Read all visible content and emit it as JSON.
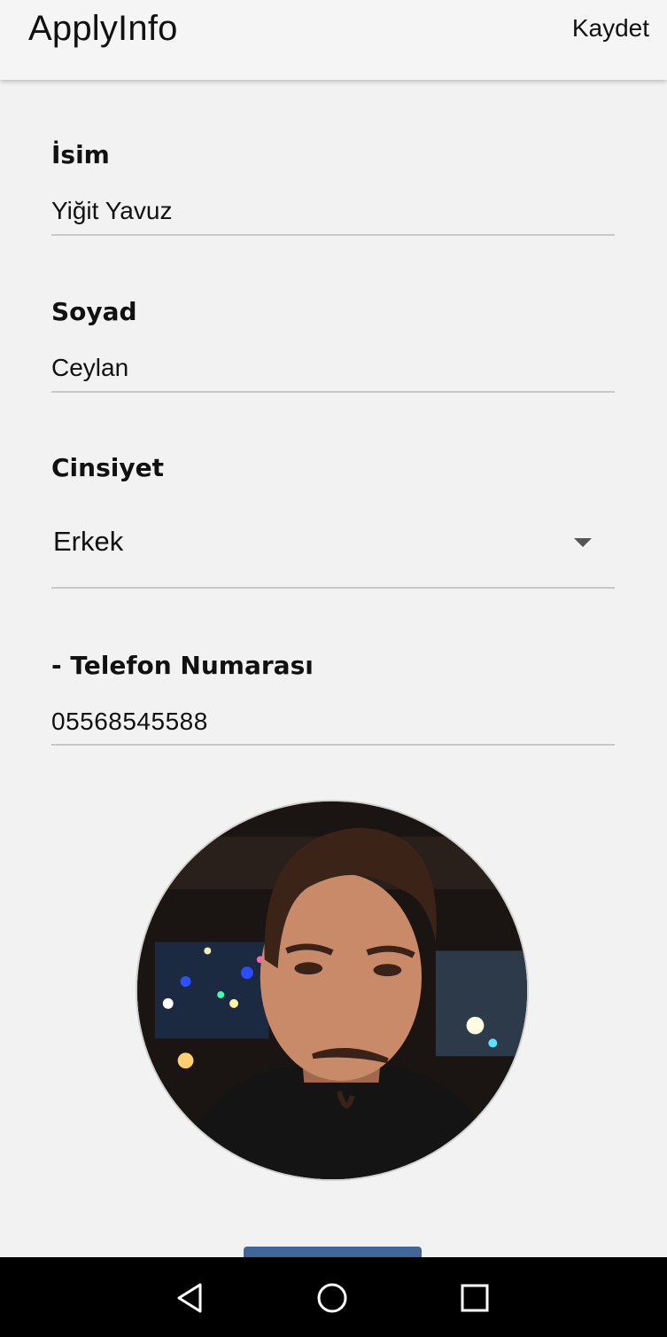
{
  "appbar": {
    "title": "ApplyInfo",
    "save_label": "Kaydet"
  },
  "form": {
    "first_name": {
      "label": "İsim",
      "value": "Yiğit Yavuz"
    },
    "last_name": {
      "label": "Soyad",
      "value": "Ceylan"
    },
    "gender": {
      "label": "Cinsiyet",
      "selected": "Erkek"
    },
    "phone": {
      "label": "- Telefon Numarası",
      "value": "05568545588"
    }
  },
  "profile_photo": {
    "icon": "avatar-photo"
  },
  "navbar": {
    "icons": [
      "back-icon",
      "home-icon",
      "recents-icon"
    ]
  },
  "colors": {
    "button_accent": "#3f6797",
    "underline": "#c8c8c8",
    "navbar": "#000000"
  }
}
